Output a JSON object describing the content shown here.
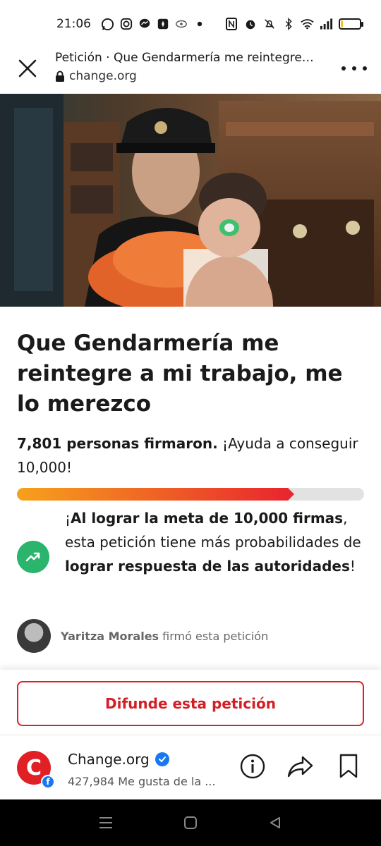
{
  "status_bar": {
    "time": "21:06",
    "icons": [
      "whatsapp-icon",
      "instagram-icon",
      "messenger-icon",
      "app-icon",
      "app-icon",
      "dot-icon",
      "nfc-icon",
      "alarm-icon",
      "mute-icon",
      "bluetooth-icon",
      "wifi-icon",
      "signal-icon",
      "battery-icon"
    ],
    "battery_level": 0.1
  },
  "header": {
    "title": "Petición · Que Gendarmería me reintegre…",
    "url": "change.org"
  },
  "petition": {
    "title": "Que Gendarmería me reintegre a mi trabajo, me lo merezco",
    "signed_bold": "7,801 personas firmaron.",
    "signed_rest": " ¡Ayuda a conseguir 10,000!",
    "signatures": 7801,
    "goal": 10000,
    "progress_fraction": 0.78
  },
  "goal_message": {
    "part1": "¡",
    "part2_bold": "Al lograr la meta de 10,000 firmas",
    "part3": ", esta petición tiene más probabilidades de ",
    "part4_bold": "lograr respuesta de las autoridades",
    "part5": "!"
  },
  "signer": {
    "name": "Yaritza Morales",
    "action": " firmó esta petición"
  },
  "share_button": "Difunde esta petición",
  "facebook_bar": {
    "logo_letter": "C",
    "badge_letter": "f",
    "page_name": "Change.org",
    "likes": "427,984 Me gusta de la ..."
  },
  "colors": {
    "accent_red": "#e12026",
    "progress_start": "#f7a21b",
    "progress_end": "#e8262e",
    "goal_icon_green": "#2bb46c",
    "facebook_blue": "#1877f2"
  }
}
